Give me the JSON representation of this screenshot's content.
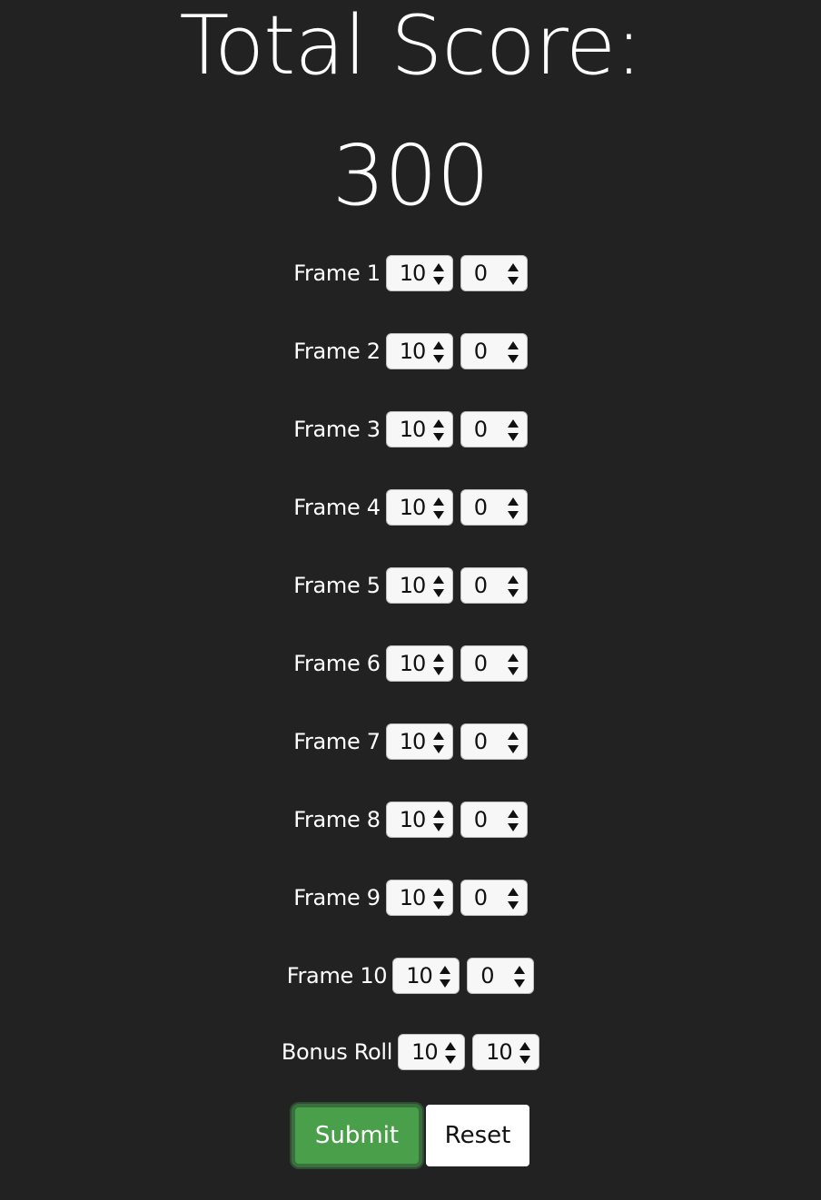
{
  "header": {
    "title": "Total Score:",
    "score": "300"
  },
  "frames": [
    {
      "label": "Frame 1",
      "roll1": "10",
      "roll2": "0"
    },
    {
      "label": "Frame 2",
      "roll1": "10",
      "roll2": "0"
    },
    {
      "label": "Frame 3",
      "roll1": "10",
      "roll2": "0"
    },
    {
      "label": "Frame 4",
      "roll1": "10",
      "roll2": "0"
    },
    {
      "label": "Frame 5",
      "roll1": "10",
      "roll2": "0"
    },
    {
      "label": "Frame 6",
      "roll1": "10",
      "roll2": "0"
    },
    {
      "label": "Frame 7",
      "roll1": "10",
      "roll2": "0"
    },
    {
      "label": "Frame 8",
      "roll1": "10",
      "roll2": "0"
    },
    {
      "label": "Frame 9",
      "roll1": "10",
      "roll2": "0"
    },
    {
      "label": "Frame 10",
      "roll1": "10",
      "roll2": "0"
    },
    {
      "label": "Bonus Roll",
      "roll1": "10",
      "roll2": "10"
    }
  ],
  "buttons": {
    "submit_label": "Submit",
    "reset_label": "Reset"
  },
  "colors": {
    "background": "#222222",
    "submit_green": "#4a9f4a",
    "text": "#ffffff"
  },
  "icons": {
    "select_arrows": "up-down-arrows-icon"
  }
}
